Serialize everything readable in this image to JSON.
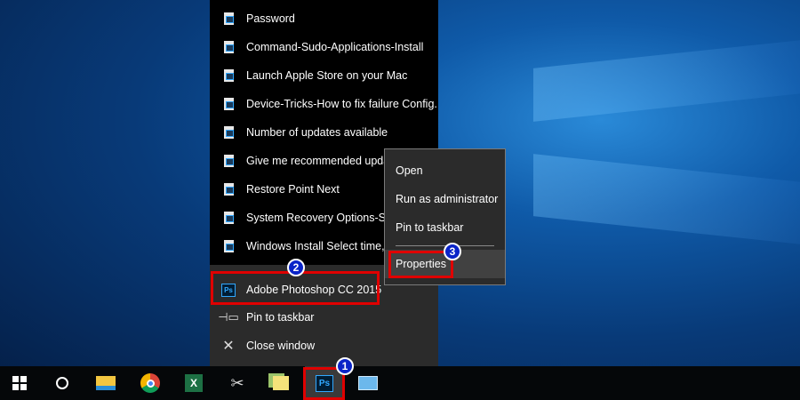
{
  "jump_list": {
    "recent": [
      "Password",
      "Command-Sudo-Applications-Install",
      "Launch Apple Store on your Mac",
      "Device-Tricks-How to fix failure Config...",
      "Number of updates available",
      "Give me recommended updates",
      "Restore Point Next",
      "System Recovery Options-System",
      "Windows Install Select time, date"
    ],
    "app_name": "Adobe Photoshop CC 2015",
    "pin": "Pin to taskbar",
    "close": "Close window"
  },
  "context_menu": {
    "items": [
      "Open",
      "Run as administrator",
      "Pin to taskbar"
    ],
    "properties": "Properties"
  },
  "badges": [
    "1",
    "2",
    "3"
  ],
  "taskbar": {
    "ps_label": "Ps"
  },
  "colors": {
    "highlight": "#e00000",
    "badge": "#0a24c8"
  }
}
